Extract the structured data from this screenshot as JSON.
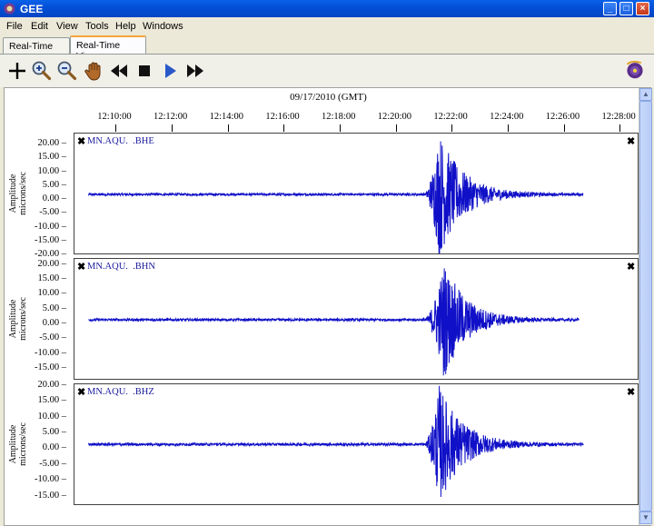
{
  "window": {
    "title": "GEE",
    "minimize": "_",
    "maximize": "□",
    "close": "×"
  },
  "menu": [
    "File",
    "Edit",
    "View",
    "Tools",
    "Help",
    "Windows"
  ],
  "tabs": [
    {
      "label": "Real-Time Map",
      "active": false
    },
    {
      "label": "Real-Time Viewer",
      "active": true
    }
  ],
  "toolbar": {
    "tools": [
      "add-icon",
      "zoom-in-icon",
      "zoom-out-icon",
      "pan-hand-icon",
      "rewind-icon",
      "stop-icon",
      "play-icon",
      "fast-forward-icon"
    ]
  },
  "viewer": {
    "date": "09/17/2010 (GMT)",
    "time_ticks": [
      "12:10:00",
      "12:12:00",
      "12:14:00",
      "12:16:00",
      "12:18:00",
      "12:20:00",
      "12:22:00",
      "12:24:00",
      "12:26:00",
      "12:28:00"
    ],
    "y_label_line1": "Amplitude",
    "y_label_line2": "microns/sec",
    "close_glyph": "✖",
    "trace_color": "#1010c8"
  },
  "chart_data": [
    {
      "type": "line",
      "name": "MN.AQU.  .BHE",
      "x_start": "12:09:00",
      "x_end": "12:27:00",
      "xlim": [
        "12:08:30",
        "12:28:40"
      ],
      "ylim": [
        -20,
        24
      ],
      "y_ticks": [
        "20.00",
        "15.00",
        "10.00",
        "5.00",
        "0.00",
        "-5.00",
        "-10.00",
        "-15.00",
        "-20.00"
      ],
      "baseline": 2.0,
      "noise_amplitude": 0.4,
      "event_onset": "12:21:00",
      "event_peak_time": "12:21:30",
      "event_peak_amplitude": 23,
      "coda_end": "12:25:00",
      "trace_end": "12:26:40"
    },
    {
      "type": "line",
      "name": "MN.AQU.  .BHN",
      "x_start": "12:09:00",
      "x_end": "12:27:00",
      "xlim": [
        "12:08:30",
        "12:28:40"
      ],
      "ylim": [
        -19,
        22
      ],
      "y_ticks": [
        "20.00",
        "15.00",
        "10.00",
        "5.00",
        "0.00",
        "-5.00",
        "-10.00",
        "-15.00"
      ],
      "baseline": 1.5,
      "noise_amplitude": 0.4,
      "event_onset": "12:21:00",
      "event_peak_time": "12:21:40",
      "event_peak_amplitude": 20,
      "coda_end": "12:25:00",
      "trace_end": "12:26:30"
    },
    {
      "type": "line",
      "name": "MN.AQU.  .BHZ",
      "x_start": "12:09:00",
      "x_end": "12:27:00",
      "xlim": [
        "12:08:30",
        "12:28:40"
      ],
      "ylim": [
        -18,
        20.5
      ],
      "y_ticks": [
        "20.00",
        "15.00",
        "10.00",
        "5.00",
        "0.00",
        "-5.00",
        "-10.00",
        "-15.00"
      ],
      "baseline": 1.5,
      "noise_amplitude": 0.4,
      "event_onset": "12:21:00",
      "event_peak_time": "12:21:30",
      "event_peak_amplitude": 19,
      "coda_end": "12:25:00",
      "trace_end": "12:26:40"
    }
  ]
}
